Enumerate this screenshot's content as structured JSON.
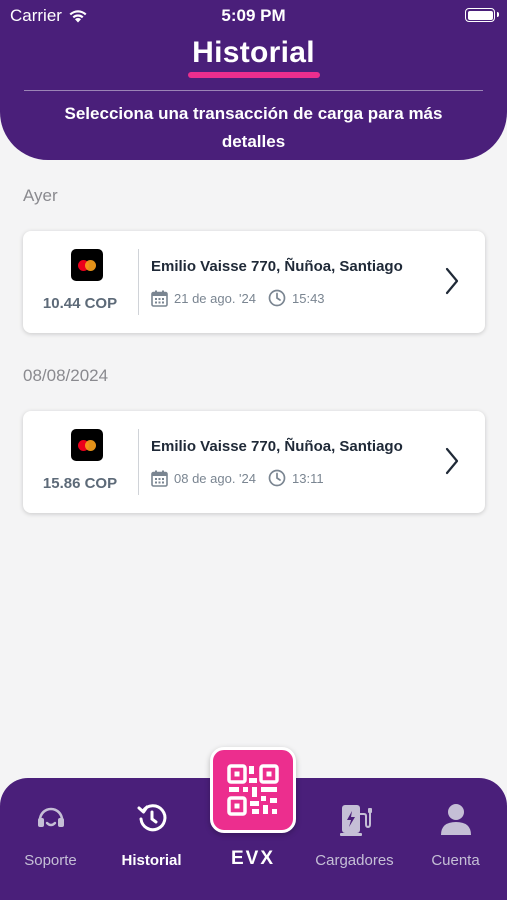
{
  "status_bar": {
    "carrier": "Carrier",
    "time": "5:09 PM"
  },
  "header": {
    "title": "Historial",
    "subtitle": "Selecciona una transacción de carga para más detalles"
  },
  "sections": [
    {
      "label": "Ayer",
      "transactions": [
        {
          "amount": "10.44 COP",
          "address": "Emilio Vaisse 770, Ñuñoa, Santiago",
          "date": "21 de ago. '24",
          "time": "15:43",
          "payment_icon": "mastercard-icon"
        }
      ]
    },
    {
      "label": "08/08/2024",
      "transactions": [
        {
          "amount": "15.86 COP",
          "address": "Emilio Vaisse 770, Ñuñoa, Santiago",
          "date": "08 de ago. '24",
          "time": "13:11",
          "payment_icon": "mastercard-icon"
        }
      ]
    }
  ],
  "bottom_nav": {
    "items": [
      {
        "label": "Soporte",
        "icon": "support-icon",
        "active": false
      },
      {
        "label": "Historial",
        "icon": "history-icon",
        "active": true
      },
      {
        "label": "Cargadores",
        "icon": "charger-icon",
        "active": false
      },
      {
        "label": "Cuenta",
        "icon": "account-icon",
        "active": false
      }
    ],
    "center_button_icon": "qr-code-icon",
    "brand": "EVX"
  },
  "colors": {
    "primary": "#4a1f7a",
    "accent": "#ec2e8e",
    "background": "#f4f4f5"
  }
}
